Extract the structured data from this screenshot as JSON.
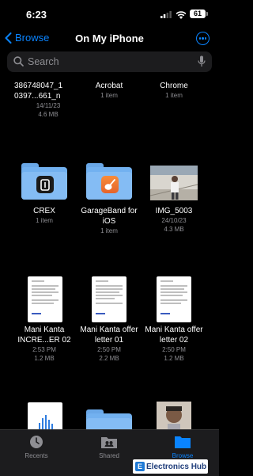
{
  "status_bar": {
    "time": "6:23",
    "battery": "61"
  },
  "nav": {
    "back_label": "Browse",
    "title": "On My iPhone"
  },
  "search": {
    "placeholder": "Search"
  },
  "files": [
    {
      "name": "386748047_1 0397...661_n",
      "date": "14/11/23",
      "size": "4.6 MB"
    },
    {
      "name": "Acrobat",
      "info": "1 item"
    },
    {
      "name": "Chrome",
      "info": "1 item"
    },
    {
      "name": "CREX",
      "info": "1 item"
    },
    {
      "name": "GarageBand for iOS",
      "info": "1 item"
    },
    {
      "name": "IMG_5003",
      "date": "24/10/23",
      "size": "4.3 MB"
    },
    {
      "name": "Mani Kanta INCRE...ER 02",
      "date": "2:53 PM",
      "size": "1.2 MB"
    },
    {
      "name": "Mani Kanta offer letter 01",
      "date": "2:50 PM",
      "size": "2.2 MB"
    },
    {
      "name": "Mani Kanta offer letter 02",
      "date": "2:50 PM",
      "size": "1.2 MB"
    }
  ],
  "tabs": [
    {
      "label": "Recents",
      "icon": "clock-icon",
      "active": false
    },
    {
      "label": "Shared",
      "icon": "shared-folder-icon",
      "active": false
    },
    {
      "label": "Browse",
      "icon": "folder-icon",
      "active": true
    }
  ],
  "watermark": {
    "text": "Electronics Hub"
  },
  "colors": {
    "accent": "#0a84ff",
    "background": "#000000",
    "folder": "#84bcf4"
  }
}
